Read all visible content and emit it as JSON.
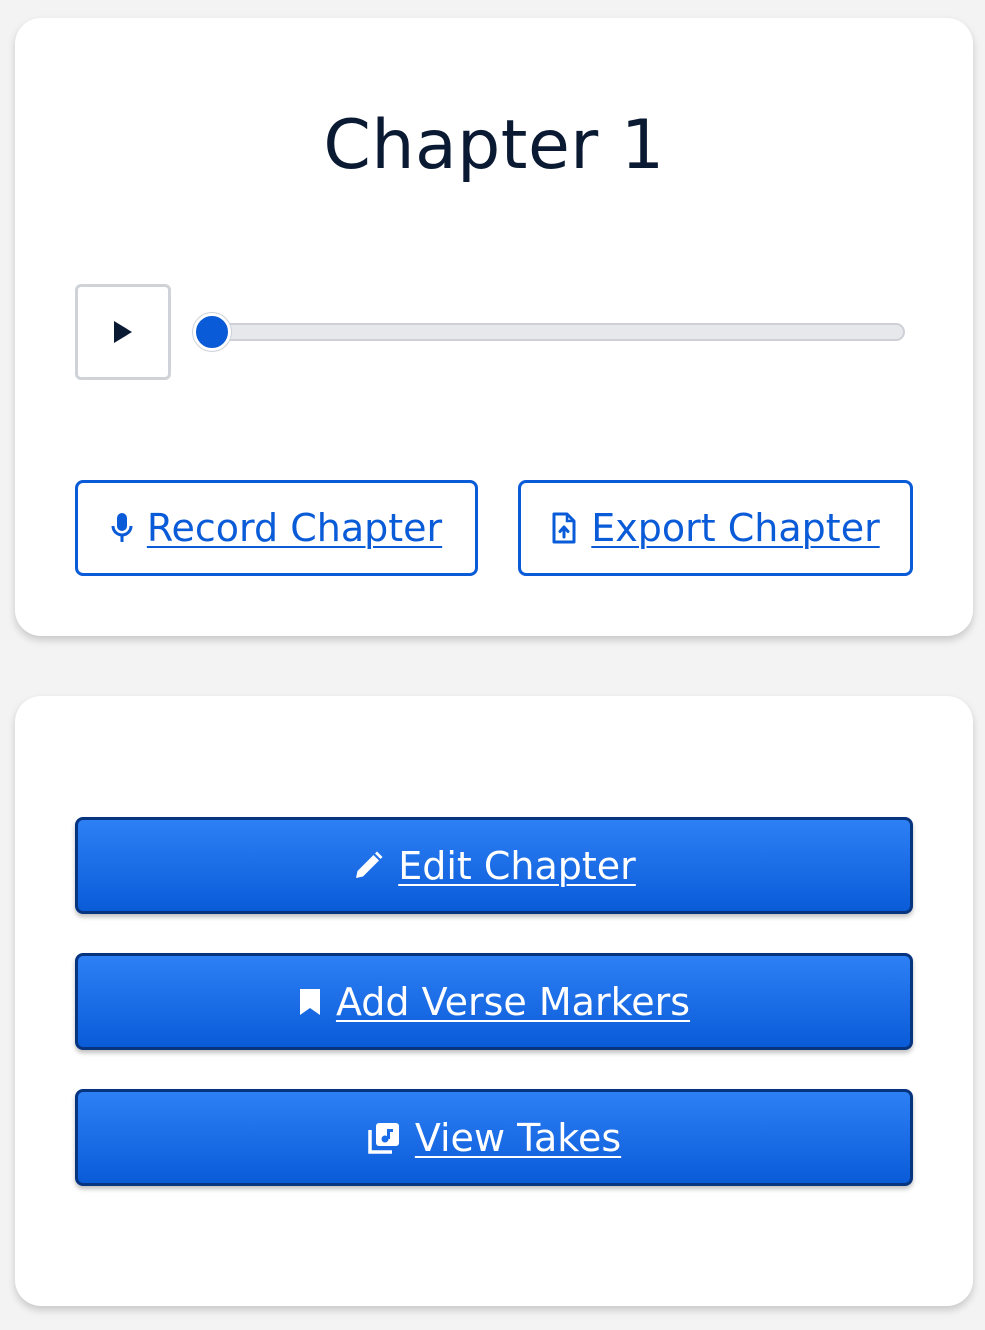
{
  "chapter_card": {
    "title": "Chapter 1",
    "player": {
      "progress": 0
    },
    "record_button": {
      "label": "Record Chapter",
      "icon": "microphone-icon"
    },
    "export_button": {
      "label": "Export Chapter",
      "icon": "file-export-icon"
    }
  },
  "actions_card": {
    "edit_button": {
      "label": "Edit Chapter",
      "icon": "pencil-icon"
    },
    "verse_markers_button": {
      "label": "Add Verse Markers",
      "icon": "bookmark-icon"
    },
    "view_takes_button": {
      "label": "View Takes",
      "icon": "music-library-icon"
    }
  },
  "colors": {
    "accent": "#0a5bd8",
    "accent_dark": "#06347f",
    "title": "#0b1a33",
    "background": "#f3f3f3",
    "card": "#ffffff"
  }
}
